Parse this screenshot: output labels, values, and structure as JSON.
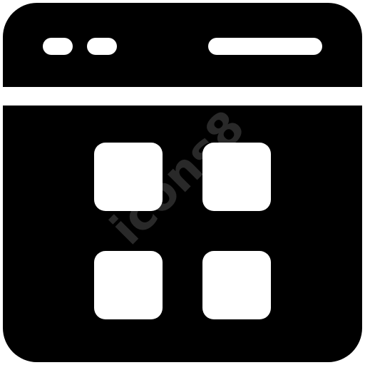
{
  "icon": {
    "name": "browser-app-grid-icon",
    "description_hidden": "",
    "colors": {
      "fill": "#000000",
      "background": "#ffffff"
    },
    "watermark": {
      "text": "icons8",
      "color": "#ffffff"
    }
  }
}
